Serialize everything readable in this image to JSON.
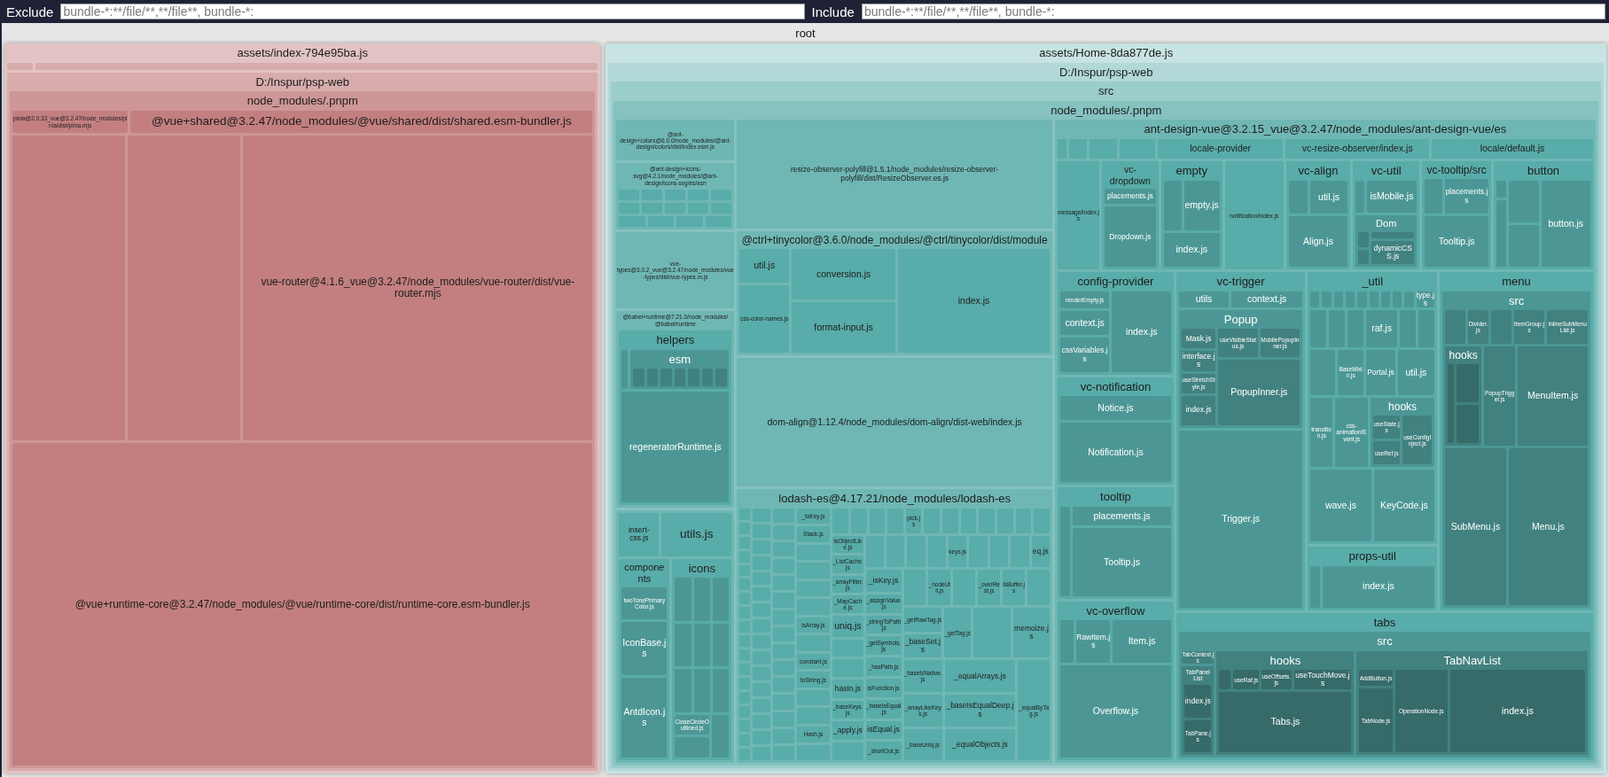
{
  "filter_bar": {
    "exclude": {
      "label": "Exclude",
      "placeholder": "bundle-*:**/file/**,**/file**, bundle-*:"
    },
    "include": {
      "label": "Include",
      "placeholder": "bundle-*:**/file/**,**/file**, bundle-*:"
    }
  },
  "root": {
    "label": "root",
    "bundles": [
      {
        "label": "assets/index-794e95ba.js",
        "color": "#e3c3c3",
        "children": [
          {
            "label": "D:/Inspur/psp-web",
            "children": [
              {
                "label": "node_modules/.pnpm",
                "children": [
                  {
                    "label": "pinia@2.0.33_vue@3.2.47/node_modules/pinia/dist/pinia.mjs"
                  },
                  {
                    "label": "@vue+shared@3.2.47/node_modules/@vue/shared/dist/shared.esm-bundler.js"
                  },
                  {
                    "label": "vue-router@4.1.6_vue@3.2.47/node_modules/vue-router/dist/vue-router.mjs"
                  },
                  {
                    "label": "@vue+runtime-core@3.2.47/node_modules/@vue/runtime-core/dist/runtime-core.esm-bundler.js"
                  }
                ]
              }
            ]
          }
        ]
      },
      {
        "label": "assets/Home-8da877de.js",
        "color": "#c7e3e2",
        "children": [
          {
            "label": "D:/Inspur/psp-web",
            "children": [
              {
                "label": "src",
                "children": [
                  {
                    "label": "node_modules/.pnpm",
                    "children": [
                      {
                        "label": "@ant-design+colors@6.0.0/node_modules/@ant-design/colors/dist/index.esm.js"
                      },
                      {
                        "label": "@ant-design+icons-svg@4.2.1/node_modules/@ant-design/icons-svg/es/asn"
                      },
                      {
                        "label": "vue-types@3.0.2_vue@3.2.47/node_modules/vue-types/dist/vue-types.m.js"
                      },
                      {
                        "label": "@babel+runtime@7.21.0/node_modules/@babel/runtime",
                        "children": [
                          {
                            "label": "helpers",
                            "children": [
                              {
                                "label": "esm"
                              },
                              {
                                "label": "regeneratorRuntime.js"
                              }
                            ]
                          }
                        ]
                      },
                      {
                        "children": [
                          {
                            "label": "insert-css.js"
                          },
                          {
                            "label": "utils.js"
                          },
                          {
                            "label": "components",
                            "children": [
                              {
                                "label": "twoTonePrimaryColor.js"
                              },
                              {
                                "label": "IconBase.js"
                              },
                              {
                                "label": "AntdIcon.js"
                              }
                            ]
                          },
                          {
                            "label": "icons",
                            "children": [
                              {
                                "label": "CloseCircleOutlined.js"
                              }
                            ]
                          }
                        ]
                      },
                      {
                        "label": "resize-observer-polyfill@1.5.1/node_modules/resize-observer-polyfill/dist/ResizeObserver.es.js"
                      },
                      {
                        "label": "@ctrl+tinycolor@3.6.0/node_modules/@ctrl/tinycolor/dist/module",
                        "children": [
                          {
                            "label": "util.js"
                          },
                          {
                            "label": "css-color-names.js"
                          },
                          {
                            "label": "conversion.js"
                          },
                          {
                            "label": "format-input.js"
                          },
                          {
                            "label": "index.js"
                          }
                        ]
                      },
                      {
                        "label": "dom-align@1.12.4/node_modules/dom-align/dist-web/index.js"
                      },
                      {
                        "label": "lodash-es@4.17.21/node_modules/lodash-es",
                        "children": [
                          {
                            "label": "_toKey.js"
                          },
                          {
                            "label": "Stack.js"
                          },
                          {
                            "label": "isArray.js"
                          },
                          {
                            "label": "constant.js"
                          },
                          {
                            "label": "toString.js"
                          },
                          {
                            "label": "Hash.js"
                          },
                          {
                            "label": "pick.js"
                          },
                          {
                            "label": "isObjectLike.js"
                          },
                          {
                            "label": "_ListCache.js"
                          },
                          {
                            "label": "_arrayFilter.js"
                          },
                          {
                            "label": "_MapCache.js"
                          },
                          {
                            "label": "uniq.js"
                          },
                          {
                            "label": "hasIn.js"
                          },
                          {
                            "label": "_baseKeys.js"
                          },
                          {
                            "label": "_apply.js"
                          },
                          {
                            "label": "keys.js"
                          },
                          {
                            "label": "eq.js"
                          },
                          {
                            "label": "_isKey.js"
                          },
                          {
                            "label": "_assignValue.js"
                          },
                          {
                            "label": "_stringToPath.js"
                          },
                          {
                            "label": "_getSymbols.js"
                          },
                          {
                            "label": "_hasPath.js"
                          },
                          {
                            "label": "isFunction.js"
                          },
                          {
                            "label": "_baseIsEqual.js"
                          },
                          {
                            "label": "isEqual.js"
                          },
                          {
                            "label": "_shortOut.js"
                          },
                          {
                            "label": "_nodeUtil.js"
                          },
                          {
                            "label": "_overRest.js"
                          },
                          {
                            "label": "isBuffer.js"
                          },
                          {
                            "label": "_getRawTag.js"
                          },
                          {
                            "label": "_baseSet.js"
                          },
                          {
                            "label": "_getTag.js"
                          },
                          {
                            "label": "memoize.js"
                          },
                          {
                            "label": "_baseIsNative.js"
                          },
                          {
                            "label": "_arrayLikeKeys.js"
                          },
                          {
                            "label": "_baseUniq.js"
                          },
                          {
                            "label": "_equalArrays.js"
                          },
                          {
                            "label": "_baseIsEqualDeep.js"
                          },
                          {
                            "label": "_equalObjects.js"
                          },
                          {
                            "label": "_equalByTag.js"
                          }
                        ]
                      },
                      {
                        "label": "ant-design-vue@3.2.15_vue@3.2.47/node_modules/ant-design-vue/es",
                        "children": [
                          {
                            "label": "locale-provider"
                          },
                          {
                            "label": "vc-resize-observer/index.js"
                          },
                          {
                            "label": "locale/default.js"
                          },
                          {
                            "label": "message/index.js"
                          },
                          {
                            "label": "vc-dropdown",
                            "children": [
                              {
                                "label": "placements.js"
                              },
                              {
                                "label": "Dropdown.js"
                              }
                            ]
                          },
                          {
                            "label": "empty",
                            "children": [
                              {
                                "label": "empty.js"
                              },
                              {
                                "label": "index.js"
                              }
                            ]
                          },
                          {
                            "label": "notification/index.js"
                          },
                          {
                            "label": "vc-align",
                            "children": [
                              {
                                "label": "util.js"
                              },
                              {
                                "label": "Align.js"
                              }
                            ]
                          },
                          {
                            "label": "vc-util",
                            "children": [
                              {
                                "label": "isMobile.js"
                              },
                              {
                                "label": "Dom",
                                "children": [
                                  {
                                    "label": "dynamicCSS.js"
                                  }
                                ]
                              }
                            ]
                          },
                          {
                            "label": "vc-tooltip/src",
                            "children": [
                              {
                                "label": "placements.js"
                              },
                              {
                                "label": "Tooltip.js"
                              }
                            ]
                          },
                          {
                            "label": "button",
                            "children": [
                              {
                                "label": "button.js"
                              }
                            ]
                          },
                          {
                            "label": "config-provider",
                            "children": [
                              {
                                "label": "renderEmpty.js"
                              },
                              {
                                "label": "context.js"
                              },
                              {
                                "label": "cssVariables.js"
                              },
                              {
                                "label": "index.js"
                              }
                            ]
                          },
                          {
                            "label": "vc-notification",
                            "children": [
                              {
                                "label": "Notice.js"
                              },
                              {
                                "label": "Notification.js"
                              }
                            ]
                          },
                          {
                            "label": "tooltip",
                            "children": [
                              {
                                "label": "placements.js"
                              },
                              {
                                "label": "Tooltip.js"
                              }
                            ]
                          },
                          {
                            "label": "vc-overflow",
                            "children": [
                              {
                                "label": "RawItem.js"
                              },
                              {
                                "label": "Item.js"
                              },
                              {
                                "label": "Overflow.js"
                              }
                            ]
                          },
                          {
                            "label": "vc-trigger",
                            "children": [
                              {
                                "label": "utils"
                              },
                              {
                                "label": "context.js"
                              },
                              {
                                "label": "Popup",
                                "children": [
                                  {
                                    "label": "Mask.js"
                                  },
                                  {
                                    "label": "interface.js"
                                  },
                                  {
                                    "label": "useStretchStyle.js"
                                  },
                                  {
                                    "label": "index.js"
                                  },
                                  {
                                    "label": "useVisibleStatus.js"
                                  },
                                  {
                                    "label": "MobilePopupInner.js"
                                  },
                                  {
                                    "label": "PopupInner.js"
                                  }
                                ]
                              },
                              {
                                "label": "Trigger.js"
                              }
                            ]
                          },
                          {
                            "label": "_util",
                            "children": [
                              {
                                "label": "type.js"
                              },
                              {
                                "label": "raf.js"
                              },
                              {
                                "label": "BaseMixin.js"
                              },
                              {
                                "label": "Portal.js"
                              },
                              {
                                "label": "util.js"
                              },
                              {
                                "label": "transition.js"
                              },
                              {
                                "label": "css-animation/Event.js"
                              },
                              {
                                "label": "hooks",
                                "children": [
                                  {
                                    "label": "useState.js"
                                  },
                                  {
                                    "label": "useRef.js"
                                  },
                                  {
                                    "label": "useConfigInject.js"
                                  }
                                ]
                              },
                              {
                                "label": "wave.js"
                              },
                              {
                                "label": "KeyCode.js"
                              }
                            ]
                          },
                          {
                            "label": "props-util",
                            "children": [
                              {
                                "label": "index.js"
                              }
                            ]
                          },
                          {
                            "label": "menu",
                            "children": [
                              {
                                "label": "src",
                                "children": [
                                  {
                                    "label": "Divider.js"
                                  },
                                  {
                                    "label": "ItemGroup.js"
                                  },
                                  {
                                    "label": "InlineSubMenuList.js"
                                  },
                                  {
                                    "label": "hooks"
                                  },
                                  {
                                    "label": "PopupTrigger.js"
                                  },
                                  {
                                    "label": "MenuItem.js"
                                  },
                                  {
                                    "label": "SubMenu.js"
                                  },
                                  {
                                    "label": "Menu.js"
                                  }
                                ]
                              }
                            ]
                          },
                          {
                            "label": "tabs",
                            "children": [
                              {
                                "label": "src",
                                "children": [
                                  {
                                    "label": "TabContext.js"
                                  },
                                  {
                                    "label": "TabPanelList",
                                    "children": [
                                      {
                                        "label": "index.js"
                                      },
                                      {
                                        "label": "TabPane.js"
                                      }
                                    ]
                                  },
                                  {
                                    "label": "hooks",
                                    "children": [
                                      {
                                        "label": "useRaf.js"
                                      },
                                      {
                                        "label": "useOffsets.js"
                                      },
                                      {
                                        "label": "useTouchMove.js"
                                      },
                                      {
                                        "label": "Tabs.js"
                                      }
                                    ]
                                  },
                                  {
                                    "label": "TabNavList",
                                    "children": [
                                      {
                                        "label": "AddButton.js"
                                      },
                                      {
                                        "label": "TabNode.js"
                                      },
                                      {
                                        "label": "OperationNode.js"
                                      },
                                      {
                                        "label": "index.js"
                                      }
                                    ]
                                  }
                                ]
                              }
                            ]
                          }
                        ]
                      }
                    ]
                  }
                ]
              }
            ]
          }
        ]
      }
    ]
  }
}
